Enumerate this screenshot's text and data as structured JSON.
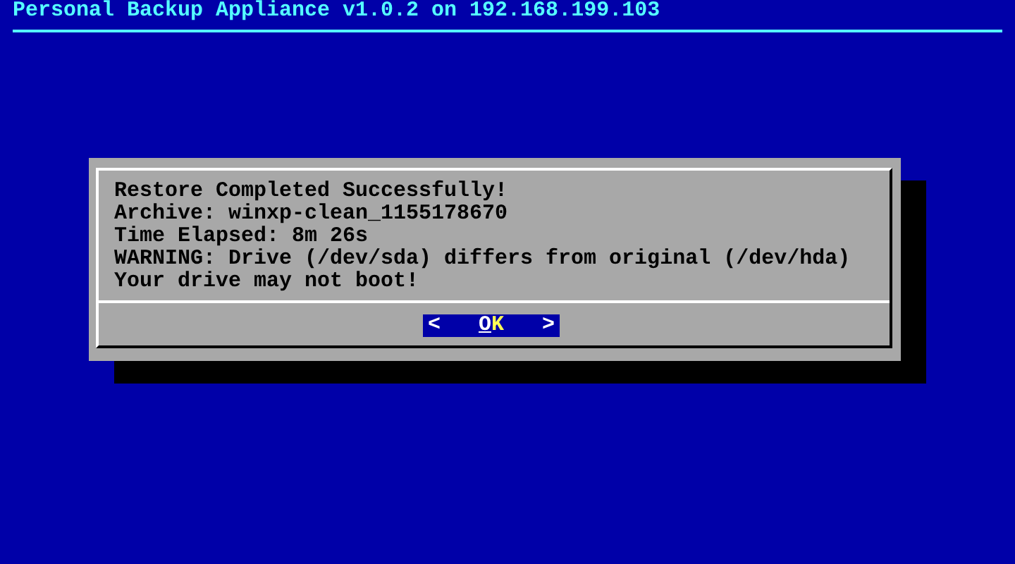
{
  "header": {
    "title": "Personal Backup Appliance v1.0.2 on 192.168.199.103"
  },
  "dialog": {
    "lines": [
      "Restore Completed Successfully!",
      "Archive: winxp-clean_1155178670",
      "Time Elapsed: 8m 26s",
      "WARNING: Drive (/dev/sda) differs from original (/dev/hda)",
      "Your drive may not boot!"
    ],
    "buttons": [
      {
        "left_mark": "<",
        "label": "OK",
        "right_mark": ">",
        "selected": true
      }
    ]
  }
}
